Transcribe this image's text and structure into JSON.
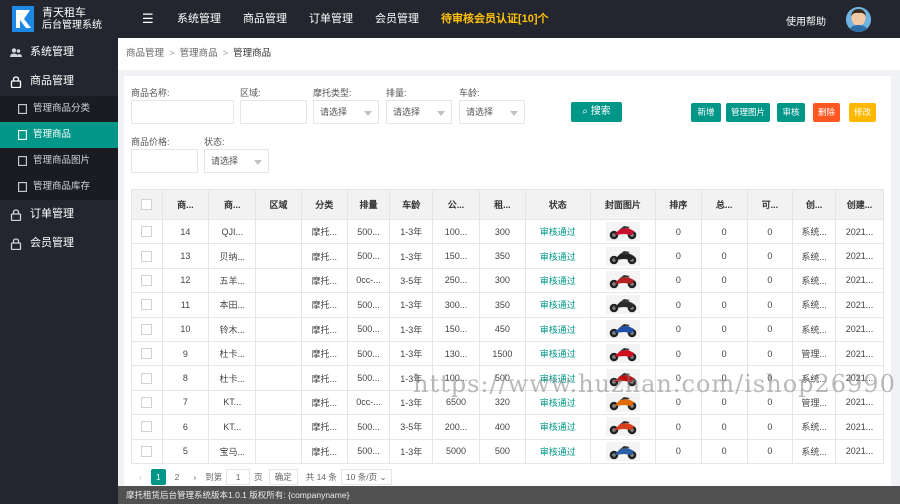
{
  "app": {
    "title_line1": "青天租车",
    "title_line2": "后台管理系统"
  },
  "topnav": {
    "items": [
      "系统管理",
      "商品管理",
      "订单管理",
      "会员管理"
    ],
    "pending_label": "待审核会员认证[10]个",
    "help_label": "使用帮助"
  },
  "sidebar": {
    "system": "系统管理",
    "goods": "商品管理",
    "sub": [
      "管理商品分类",
      "管理商品",
      "管理商品图片",
      "管理商品库存"
    ],
    "orders": "订单管理",
    "members": "会员管理"
  },
  "breadcrumb": [
    "商品管理",
    "管理商品",
    "管理商品"
  ],
  "filters": {
    "name_label": "商品名称:",
    "region_label": "区域:",
    "moto_type_label": "摩托类型:",
    "displacement_label": "排量:",
    "age_label": "车龄:",
    "price_label": "商品价格:",
    "status_label": "状态:",
    "select_placeholder": "请选择",
    "search_label": "搜索"
  },
  "actions": {
    "add": "新增",
    "manage_images": "管理图片",
    "review": "审核",
    "delete": "删除",
    "edit": "修改"
  },
  "colors": {
    "teal": "#009688",
    "delete": "#ff5722",
    "edit": "#ffb800",
    "dark": "#23262e",
    "pending": "#ffc107"
  },
  "table": {
    "headers": [
      "商...",
      "商...",
      "区域",
      "分类",
      "排量",
      "车龄",
      "公...",
      "租...",
      "状态",
      "封面图片",
      "排序",
      "总...",
      "可...",
      "创...",
      "创建..."
    ],
    "rows": [
      [
        "14",
        "QJI...",
        "",
        "摩托...",
        "500...",
        "1-3年",
        "100...",
        "300",
        "审核通过",
        "0",
        "0",
        "0",
        "系统...",
        "2021..."
      ],
      [
        "13",
        "贝纳...",
        "",
        "摩托...",
        "500...",
        "1-3年",
        "150...",
        "350",
        "审核通过",
        "0",
        "0",
        "0",
        "系统...",
        "2021..."
      ],
      [
        "12",
        "五羊...",
        "",
        "摩托...",
        "0cc-...",
        "3-5年",
        "250...",
        "300",
        "审核通过",
        "0",
        "0",
        "0",
        "系统...",
        "2021..."
      ],
      [
        "11",
        "本田...",
        "",
        "摩托...",
        "500...",
        "1-3年",
        "300...",
        "350",
        "审核通过",
        "0",
        "0",
        "0",
        "系统...",
        "2021..."
      ],
      [
        "10",
        "铃木...",
        "",
        "摩托...",
        "500...",
        "1-3年",
        "150...",
        "450",
        "审核通过",
        "0",
        "0",
        "0",
        "系统...",
        "2021..."
      ],
      [
        "9",
        "杜卡...",
        "",
        "摩托...",
        "500...",
        "1-3年",
        "130...",
        "1500",
        "审核通过",
        "0",
        "0",
        "0",
        "管理...",
        "2021..."
      ],
      [
        "8",
        "杜卡...",
        "",
        "摩托...",
        "500...",
        "1-3年",
        "100...",
        "500",
        "审核通过",
        "0",
        "0",
        "0",
        "系统...",
        "2021..."
      ],
      [
        "7",
        "KT...",
        "",
        "摩托...",
        "0cc-...",
        "1-3年",
        "6500",
        "320",
        "审核通过",
        "0",
        "0",
        "0",
        "管理...",
        "2021..."
      ],
      [
        "6",
        "KT...",
        "",
        "摩托...",
        "500...",
        "3-5年",
        "200...",
        "400",
        "审核通过",
        "0",
        "0",
        "0",
        "系统...",
        "2021..."
      ],
      [
        "5",
        "宝马...",
        "",
        "摩托...",
        "500...",
        "1-3年",
        "5000",
        "500",
        "审核通过",
        "0",
        "0",
        "0",
        "系统...",
        "2021..."
      ]
    ],
    "bike_colors": [
      "#c8102e",
      "#222222",
      "#b22222",
      "#2a2a2a",
      "#1f4fa8",
      "#d01020",
      "#c01010",
      "#e06a00",
      "#d9411e",
      "#2b5fa6"
    ]
  },
  "pager": {
    "pages": [
      "1",
      "2"
    ],
    "goto_label": "到第",
    "goto_value": "1",
    "page_unit": "页",
    "confirm_label": "确定",
    "total_label": "共 14 条",
    "page_size_label": "10 条/页"
  },
  "footer": {
    "text": "摩托租赁后台管理系统版本1.0.1 版权所有: {companyname}"
  },
  "watermark": "https://www.huzhan.com/ishop26990"
}
